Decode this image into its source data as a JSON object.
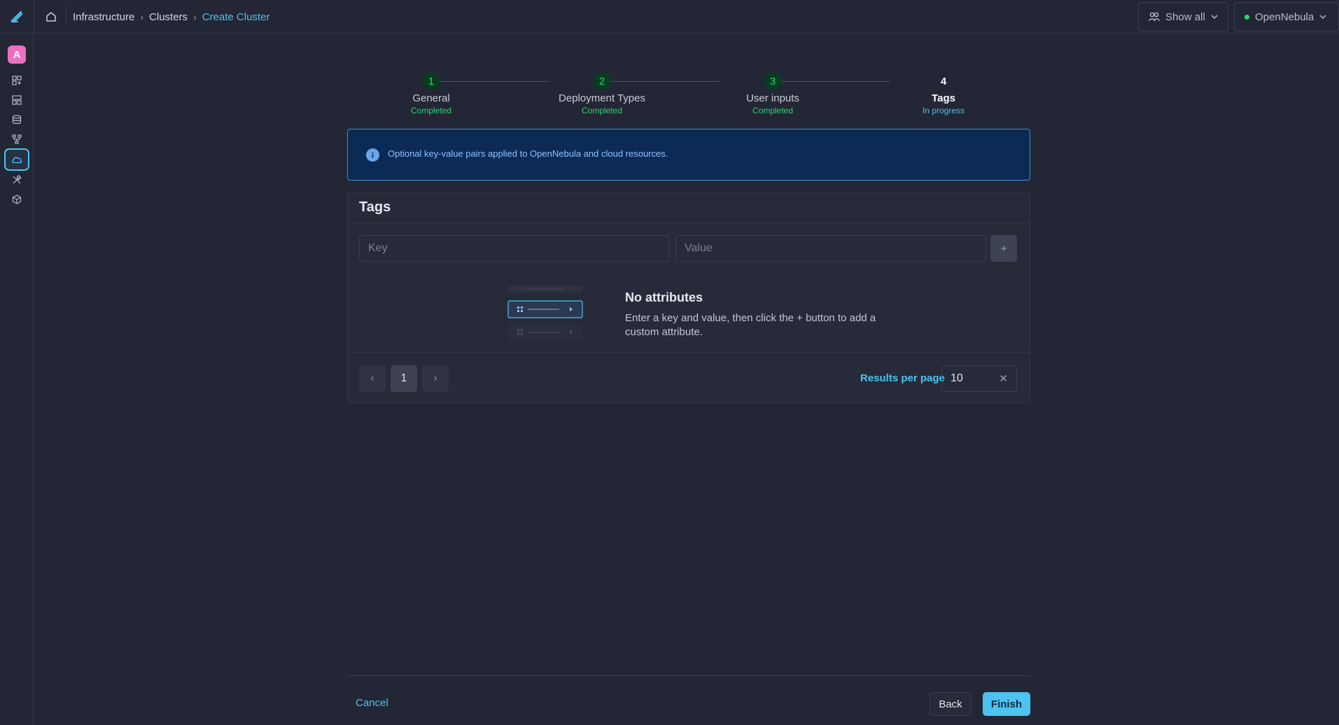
{
  "breadcrumb": {
    "items": [
      "Infrastructure",
      "Clusters"
    ],
    "current": "Create Cluster"
  },
  "topbar": {
    "filter_label": "Show all",
    "environment_label": "OpenNebula",
    "environment_status_color": "#2ed47a"
  },
  "sidebar": {
    "avatar_letter": "A",
    "items": [
      {
        "icon": "dashboard-icon"
      },
      {
        "icon": "instances-icon"
      },
      {
        "icon": "storage-icon"
      },
      {
        "icon": "network-icon"
      },
      {
        "icon": "cloud-icon",
        "active": true
      },
      {
        "icon": "tools-icon"
      },
      {
        "icon": "modules-icon"
      }
    ]
  },
  "stepper": {
    "steps": [
      {
        "number": "1",
        "title": "General",
        "status": "Completed"
      },
      {
        "number": "2",
        "title": "Deployment Types",
        "status": "Completed"
      },
      {
        "number": "3",
        "title": "User inputs",
        "status": "Completed"
      },
      {
        "number": "4",
        "title": "Tags",
        "status": "In progress"
      }
    ]
  },
  "alert": {
    "text": "Optional key-value pairs applied to OpenNebula and cloud resources."
  },
  "tags": {
    "title": "Tags",
    "key_placeholder": "Key",
    "value_placeholder": "Value",
    "add_label": "+",
    "empty_title": "No attributes",
    "empty_description": "Enter a key and value, then click the + button to add a custom attribute.",
    "pagination": {
      "current_page": "1",
      "results_per_page_label": "Results per page",
      "results_per_page_value": "10"
    }
  },
  "actions": {
    "cancel_label": "Cancel",
    "back_label": "Back",
    "finish_label": "Finish"
  },
  "colors": {
    "accent": "#4cc3f1",
    "success": "#2fd37b",
    "background": "#232634",
    "alert_background": "#0b2a55"
  }
}
